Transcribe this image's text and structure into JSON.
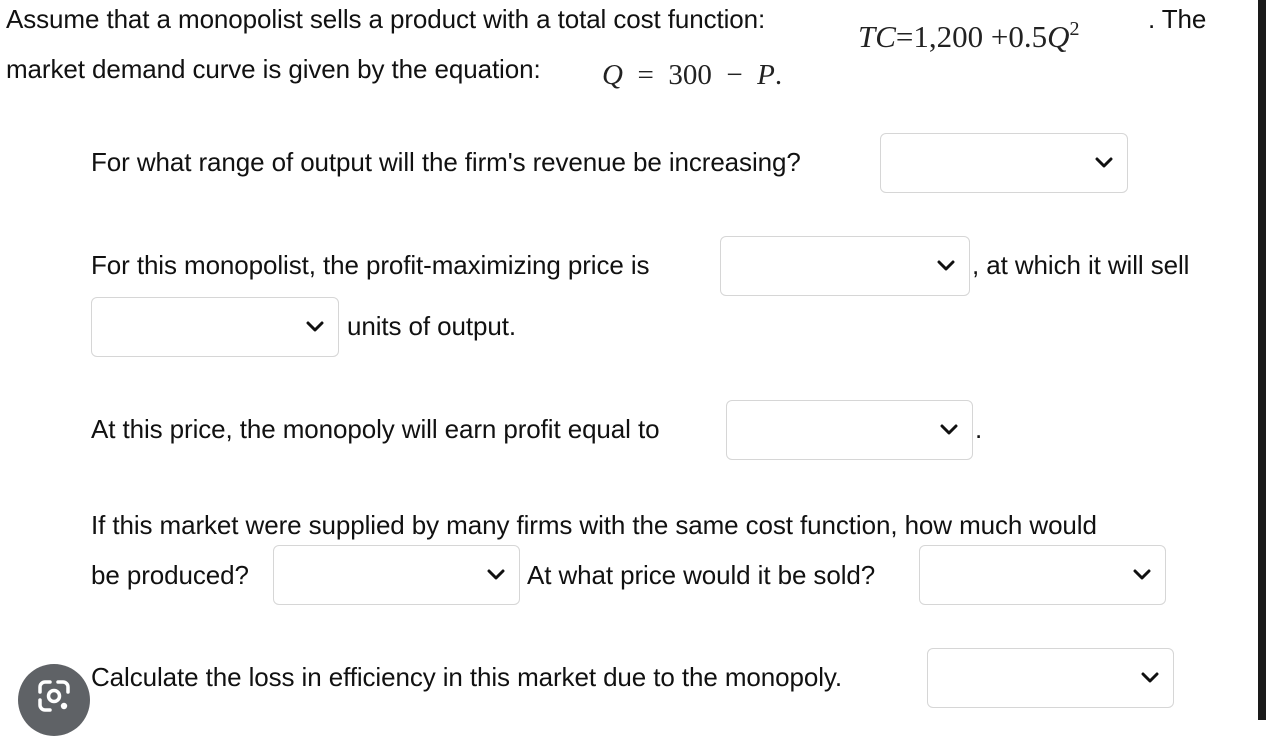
{
  "intro": {
    "line1_text": "Assume that a monopolist sells a product with a total cost function:",
    "tc_lhs": "TC",
    "tc_eq": "=",
    "tc_const": "1,200",
    "tc_plus": "+",
    "tc_coef": "0.5",
    "tc_var": "Q",
    "tc_exp": "2",
    "line1_tail": ". The",
    "line2_text": "market demand curve is given by the equation:",
    "dem_q": "Q",
    "dem_eq": "=",
    "dem_300": "300",
    "dem_minus": "−",
    "dem_p": "P",
    "dem_period": "."
  },
  "q1": {
    "text": "For what range of output will the firm's revenue be increasing?",
    "select_value": ""
  },
  "q2": {
    "text_a": "For this monopolist, the profit-maximizing price is",
    "select_price_value": "",
    "text_b": ", at which it will sell",
    "select_units_value": "",
    "text_c": "units of output."
  },
  "q3": {
    "text": "At this price, the monopoly will earn profit equal to",
    "select_value": "",
    "period": "."
  },
  "q4": {
    "text_line1": "If this market were supplied by many firms with the same cost function, how much would",
    "text_line2": "be produced?",
    "select_qty_value": "",
    "text_price": "At what price would it be sold?",
    "select_price_value": ""
  },
  "q5": {
    "text": "Calculate the loss in efficiency in this market due to the monopoly.",
    "select_value": ""
  },
  "icons": {
    "dropdown_chevron": "chevron-down-icon",
    "lens": "google-lens-icon"
  },
  "colors": {
    "text": "#111111",
    "select_border": "#d6d6d6",
    "lens_bg": "#5f6266",
    "scrollbar": "#1a1a1a"
  }
}
